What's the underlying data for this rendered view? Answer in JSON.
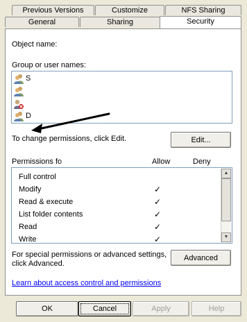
{
  "tabs": {
    "back_row": [
      {
        "label": "Previous Versions"
      },
      {
        "label": "Customize"
      },
      {
        "label": "NFS Sharing"
      }
    ],
    "front_row": [
      {
        "label": "General"
      },
      {
        "label": "Sharing"
      },
      {
        "label": "Security",
        "active": true
      }
    ]
  },
  "security": {
    "object_name_label": "Object name:",
    "object_name_value": "",
    "group_label": "Group or user names:",
    "users": [
      {
        "label": "S",
        "icon": "users-group-icon"
      },
      {
        "label": "",
        "icon": "users-group-icon"
      },
      {
        "label": "",
        "icon": "user-denied-icon"
      },
      {
        "label": "D",
        "icon": "users-group-icon"
      }
    ],
    "change_text": "To change permissions, click Edit.",
    "edit_button": "Edit...",
    "permissions_label": "Permissions fo",
    "allow_header": "Allow",
    "deny_header": "Deny",
    "permissions": [
      {
        "name": "Full control",
        "allow": "",
        "deny": ""
      },
      {
        "name": "Modify",
        "allow": "✓",
        "deny": ""
      },
      {
        "name": "Read & execute",
        "allow": "✓",
        "deny": ""
      },
      {
        "name": "List folder contents",
        "allow": "✓",
        "deny": ""
      },
      {
        "name": "Read",
        "allow": "✓",
        "deny": ""
      },
      {
        "name": "Write",
        "allow": "✓",
        "deny": ""
      }
    ],
    "special_text_line1": "For special permissions or advanced settings,",
    "special_text_line2": "click Advanced.",
    "advanced_button": "Advanced",
    "learn_link": "Learn about access control and permissions"
  },
  "footer": {
    "ok": "OK",
    "cancel": "Cancel",
    "apply": "Apply",
    "help": "Help"
  },
  "colors": {
    "dialog_bg": "#ece9d8",
    "list_border": "#7f9db9",
    "link": "#0000ff",
    "arrow": "#000000"
  }
}
